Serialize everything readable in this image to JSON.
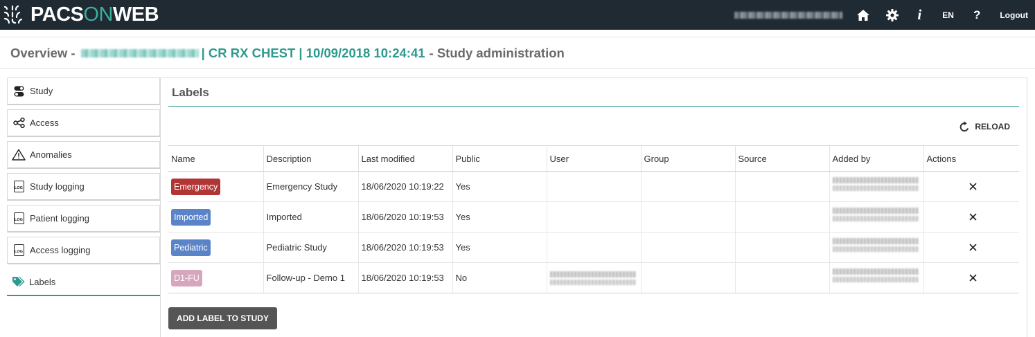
{
  "header": {
    "logo_part1": "PACS",
    "logo_part2": "ON",
    "logo_part3": "WEB",
    "lang": "EN",
    "help": "?",
    "info": "i",
    "logout": "Logout"
  },
  "title": {
    "prefix": "Overview -",
    "study": "| CR RX CHEST | 10/09/2018 10:24:41",
    "suffix": "- Study administration"
  },
  "sidebar": {
    "items": [
      {
        "label": "Study",
        "icon": "toggle-icon"
      },
      {
        "label": "Access",
        "icon": "share-icon"
      },
      {
        "label": "Anomalies",
        "icon": "warning-icon"
      },
      {
        "label": "Study logging",
        "icon": "log-icon"
      },
      {
        "label": "Patient logging",
        "icon": "log-icon"
      },
      {
        "label": "Access logging",
        "icon": "log-icon"
      },
      {
        "label": "Labels",
        "icon": "tags-icon"
      }
    ],
    "active": "Labels",
    "log_badge": "LOG"
  },
  "panel": {
    "title": "Labels",
    "reload": "RELOAD",
    "add_button": "ADD LABEL TO STUDY",
    "columns": [
      "Name",
      "Description",
      "Last modified",
      "Public",
      "User",
      "Group",
      "Source",
      "Added by",
      "Actions"
    ],
    "rows": [
      {
        "name": "Emergency",
        "color": "#b23535",
        "description": "Emergency Study",
        "modified": "18/06/2020 10:19:22",
        "public": "Yes"
      },
      {
        "name": "Imported",
        "color": "#5b84c8",
        "description": "Imported",
        "modified": "18/06/2020 10:19:53",
        "public": "Yes"
      },
      {
        "name": "Pediatric",
        "color": "#5b84c8",
        "description": "Pediatric Study",
        "modified": "18/06/2020 10:19:53",
        "public": "Yes"
      },
      {
        "name": "D1-FU",
        "color": "#d6a6bd",
        "description": "Follow-up - Demo 1",
        "modified": "18/06/2020 10:19:53",
        "public": "No"
      }
    ]
  },
  "colors": {
    "topbar": "#1f2a33",
    "accent": "#2c9a8e",
    "logo_on": "#3aaea0",
    "button": "#555555"
  }
}
